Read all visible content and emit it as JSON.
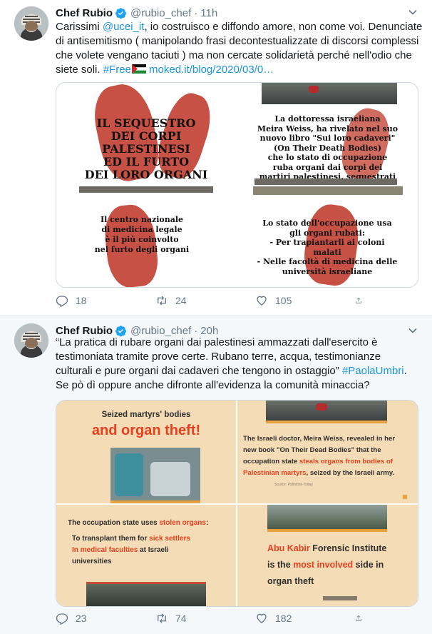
{
  "tweets": [
    {
      "name": "Chef Rubio",
      "handle": "@rubio_chef",
      "dot": "·",
      "time": "11h",
      "text_lines": [
        [
          {
            "t": "Carissimi "
          },
          {
            "t": "@ucei_it",
            "link": true
          },
          {
            "t": ", io costruisco e diffondo amore, non come voi. Denunciate"
          }
        ],
        [
          {
            "t": "di antisemitismo ( manipolando frasi decontestualizzate di discorsi complessi"
          }
        ],
        [
          {
            "t": "che volete vengano taciuti ) ma non cercate solidarietà perché nell'odio che"
          }
        ],
        [
          {
            "t": "siete soli. "
          },
          {
            "t": "#Free",
            "link": true
          },
          {
            "t": "FLAG"
          },
          {
            "t": "  moked.it/blog/2020/03/0…",
            "link": true
          }
        ]
      ],
      "media": {
        "panel1": [
          "IL SEQUESTRO",
          "DEI CORPI",
          "PALESTINESI",
          "ED IL FURTO",
          "DEI LORO ORGANI"
        ],
        "panel2": [
          "La dottoressa israeliana",
          "Meira Weiss, ha rivelato nel suo",
          "nuovo libro \"Sui loro cadaveri\"",
          "(On Their Death Bodies)",
          "che lo stato di occupazione",
          "ruba organi dai corpi dei",
          "martiri palestinesi, sequestrati"
        ],
        "panel3": [
          "Il centro nazionale",
          "di medicina legale",
          "è il più coinvolto",
          "nel furto degli organi"
        ],
        "panel4": [
          "Lo stato dell'occupazione usa",
          "gli organi rubati:",
          "- Per trapiantarli ai coloni",
          "malati",
          "- Nelle facoltà di medicina delle",
          "università israeliane"
        ]
      },
      "replies": "18",
      "retweets": "24",
      "likes": "105"
    },
    {
      "name": "Chef Rubio",
      "handle": "@rubio_chef",
      "dot": "·",
      "time": "20h",
      "text_lines": [
        [
          {
            "t": "“La pratica di rubare organi dai palestinesi ammazzati dall'esercito è"
          }
        ],
        [
          {
            "t": "testimoniata tramite prove certe. Rubano terre, acqua, testimonianze"
          }
        ],
        [
          {
            "t": "culturali e pure organi dai cadaveri che tengono in ostaggio” "
          },
          {
            "t": "#PaolaUmbri",
            "link": true
          },
          {
            "t": "."
          }
        ],
        [
          {
            "t": "Se pò dì oppure anche difronte all'evidenza la comunità minaccia?"
          }
        ]
      ],
      "media": {
        "panel1_a": "Seized martyrs' bodies",
        "panel1_b": "and organ theft!",
        "panel2": [
          [
            {
              "t": "The Israeli doctor, Meira Weiss, revealed in her"
            }
          ],
          [
            {
              "t": "new book \"On Their Dead Bodies\" that the"
            }
          ],
          [
            {
              "t": "occupation state "
            },
            {
              "t": "steals organs from bodies of",
              "o": true
            }
          ],
          [
            {
              "t": "Palestinian martyrs",
              "o": true
            },
            {
              "t": ", seized by the Israeli army."
            }
          ]
        ],
        "panel2_source": "Source: Palestine Today",
        "panel3": [
          [
            {
              "t": "The occupation state uses "
            },
            {
              "t": "stolen organs",
              "o": true
            },
            {
              "t": ":"
            }
          ],
          [
            {
              "t": "To transplant them for "
            },
            {
              "t": "sick settlers",
              "o": true
            }
          ],
          [
            {
              "t": "In medical faculties",
              "o": true
            },
            {
              "t": " at Israeli"
            }
          ],
          [
            {
              "t": "universities"
            }
          ]
        ],
        "panel4": [
          [
            {
              "t": "Abu Kabir",
              "o": true
            },
            {
              "t": " Forensic Institute"
            }
          ],
          [
            {
              "t": "is the "
            },
            {
              "t": "most involved",
              "o": true
            },
            {
              "t": " side in"
            }
          ],
          [
            {
              "t": "organ theft"
            }
          ]
        ]
      },
      "replies": "23",
      "retweets": "74",
      "likes": "182"
    }
  ],
  "colors": {
    "link": "#1b95e0",
    "muted": "#657786",
    "verified": "#1da1f2",
    "accent_orange": "#e8401c",
    "panel_bg": "#f4dcb6",
    "hand_red": "#c0392b"
  },
  "icons": [
    "verified-badge-icon",
    "chevron-down-icon",
    "reply-icon",
    "retweet-icon",
    "like-icon",
    "share-icon",
    "palestine-flag-icon"
  ]
}
